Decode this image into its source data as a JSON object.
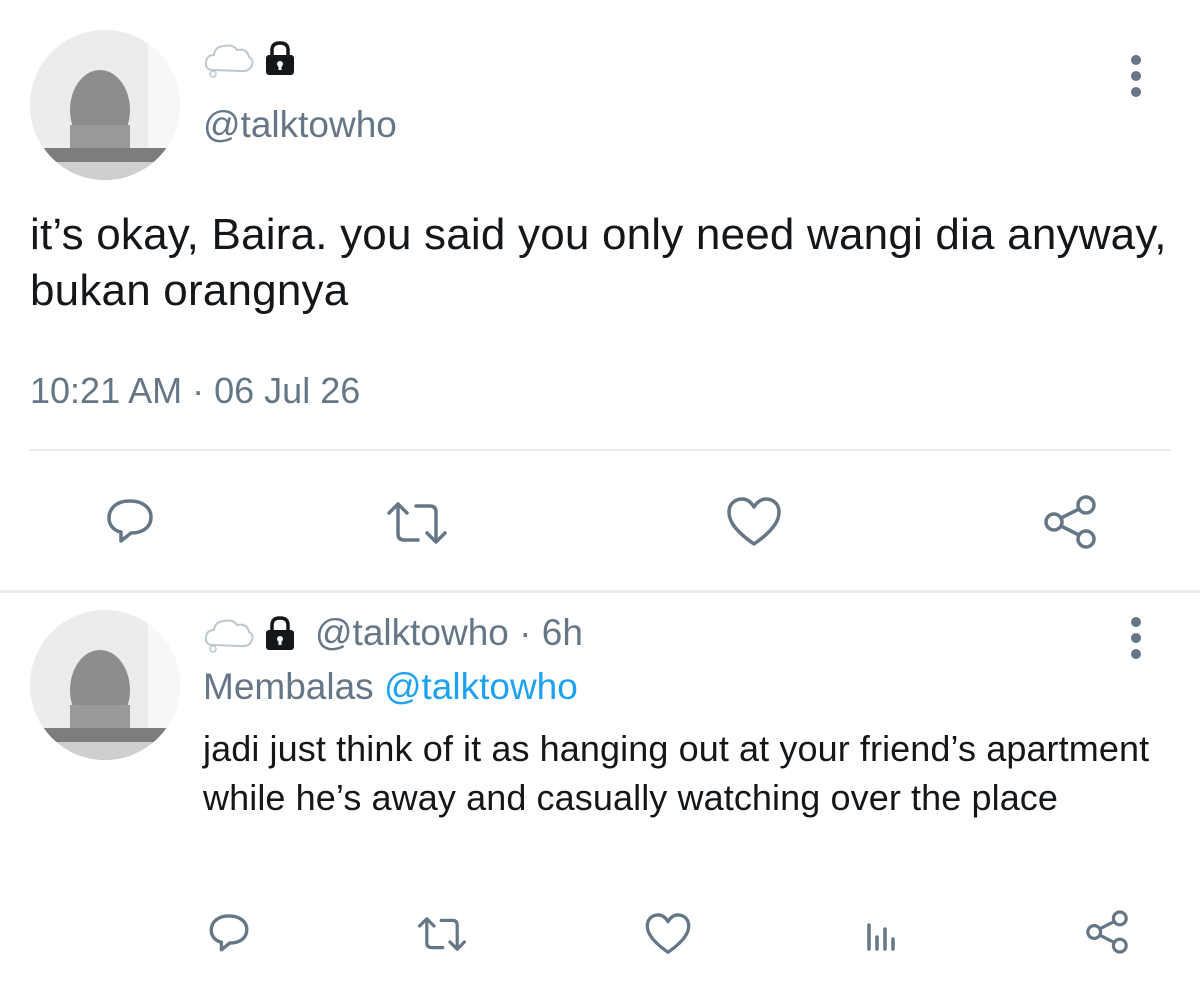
{
  "main_tweet": {
    "handle": "@talktowho",
    "text": "it’s okay, Baira. you said you only need wangi dia anyway, bukan orangnya",
    "time": "10:21 AM",
    "separator": "·",
    "date": "06 Jul 26",
    "icons": [
      "cloud-icon",
      "lock-icon",
      "more-vertical-icon",
      "reply-icon",
      "retweet-icon",
      "like-icon",
      "share-icon"
    ]
  },
  "reply_tweet": {
    "handle": "@talktowho",
    "separator": "·",
    "age": "6h",
    "replying_prefix": "Membalas",
    "replying_to": "@talktowho",
    "text": "jadi just think of it as hanging out at your friend’s apartment while he’s away and casually watching over the place",
    "icons": [
      "cloud-icon",
      "lock-icon",
      "more-vertical-icon",
      "reply-icon",
      "retweet-icon",
      "like-icon",
      "analytics-icon",
      "share-icon"
    ]
  },
  "colors": {
    "text": "#14171a",
    "secondary": "#657786",
    "link": "#1da1f2",
    "divider": "#e6ecf0"
  }
}
